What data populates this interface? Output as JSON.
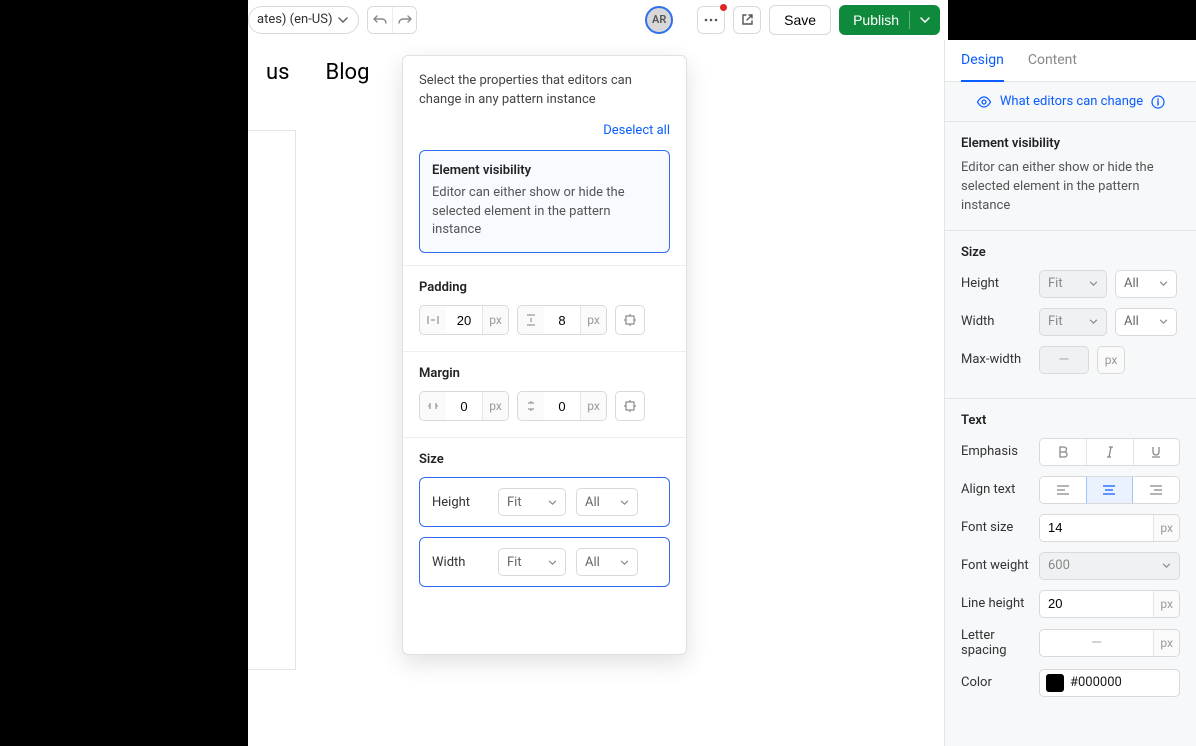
{
  "topbar": {
    "locale_label": "ates) (en-US)",
    "avatar_initials": "AR",
    "save_label": "Save",
    "publish_label": "Publish"
  },
  "canvas": {
    "nav_item_1": "us",
    "nav_item_2": "Blog"
  },
  "tabs": {
    "design": "Design",
    "content": "Content"
  },
  "banner": {
    "text": "What editors can change"
  },
  "right": {
    "visibility_title": "Element visibility",
    "visibility_desc": "Editor can either show or hide the selected element in the pattern instance",
    "size_title": "Size",
    "height_label": "Height",
    "width_label": "Width",
    "maxwidth_label": "Max-width",
    "fit_option": "Fit",
    "all_option": "All",
    "maxwidth_value": "—",
    "px_unit": "px",
    "text_title": "Text",
    "emphasis_label": "Emphasis",
    "align_label": "Align text",
    "fontsize_label": "Font size",
    "fontsize_value": "14",
    "fontweight_label": "Font weight",
    "fontweight_value": "600",
    "lineheight_label": "Line height",
    "lineheight_value": "20",
    "letterspacing_label": "Letter spacing",
    "letterspacing_value": "—",
    "color_label": "Color",
    "color_value": "#000000"
  },
  "popover": {
    "intro": "Select the properties that editors can change in any pattern instance",
    "deselect": "Deselect all",
    "visibility_title": "Element visibility",
    "visibility_desc": "Editor can either show or hide the selected element in the pattern instance",
    "padding_title": "Padding",
    "padding_h": "20",
    "padding_v": "8",
    "margin_title": "Margin",
    "margin_h": "0",
    "margin_v": "0",
    "px_unit": "px",
    "size_title": "Size",
    "height_label": "Height",
    "width_label": "Width",
    "fit_option": "Fit",
    "all_option": "All"
  }
}
